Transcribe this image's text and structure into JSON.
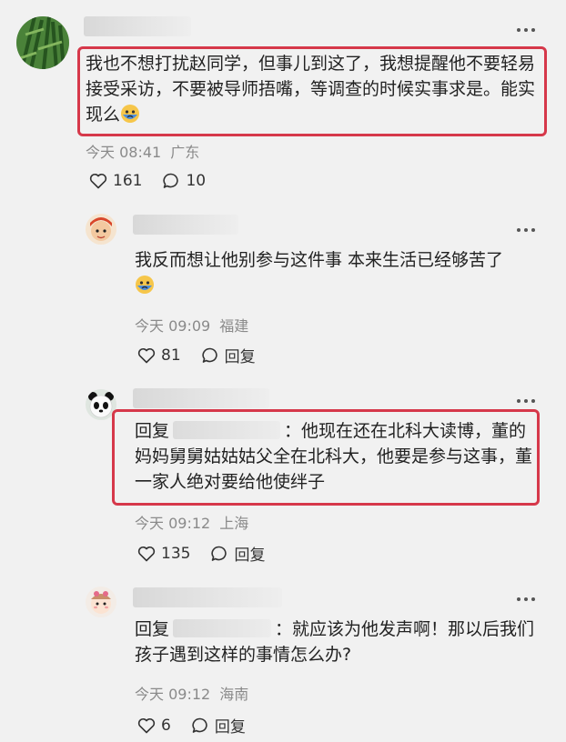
{
  "comments": [
    {
      "text": "我也不想打扰赵同学，但事儿到这了，我想提醒他不要轻易接受采访，不要被导师捂嘴，等调查的时候实事求是。能实现么",
      "time": "今天 08:41",
      "location": "广东",
      "likes": "161",
      "replies": "10"
    },
    {
      "text": "我反而想让他别参与这件事 本来生活已经够苦了",
      "time": "今天 09:09",
      "location": "福建",
      "likes": "81",
      "reply_label": "回复"
    },
    {
      "reply_prefix": "回复",
      "text": "：他现在还在北科大读博，董的妈妈舅舅姑姑姑父全在北科大，他要是参与这事，董一家人绝对要给他使绊子",
      "time": "今天 09:12",
      "location": "上海",
      "likes": "135",
      "reply_label": "回复"
    },
    {
      "reply_prefix": "回复",
      "text": "：就应该为他发声啊！那以后我们孩子遇到这样的事情怎么办?",
      "time": "今天 09:12",
      "location": "海南",
      "likes": "6",
      "reply_label": "回复"
    }
  ],
  "colors": {
    "highlight": "#d6384a",
    "meta": "#8a8a8a",
    "background": "#f1f1f1"
  }
}
